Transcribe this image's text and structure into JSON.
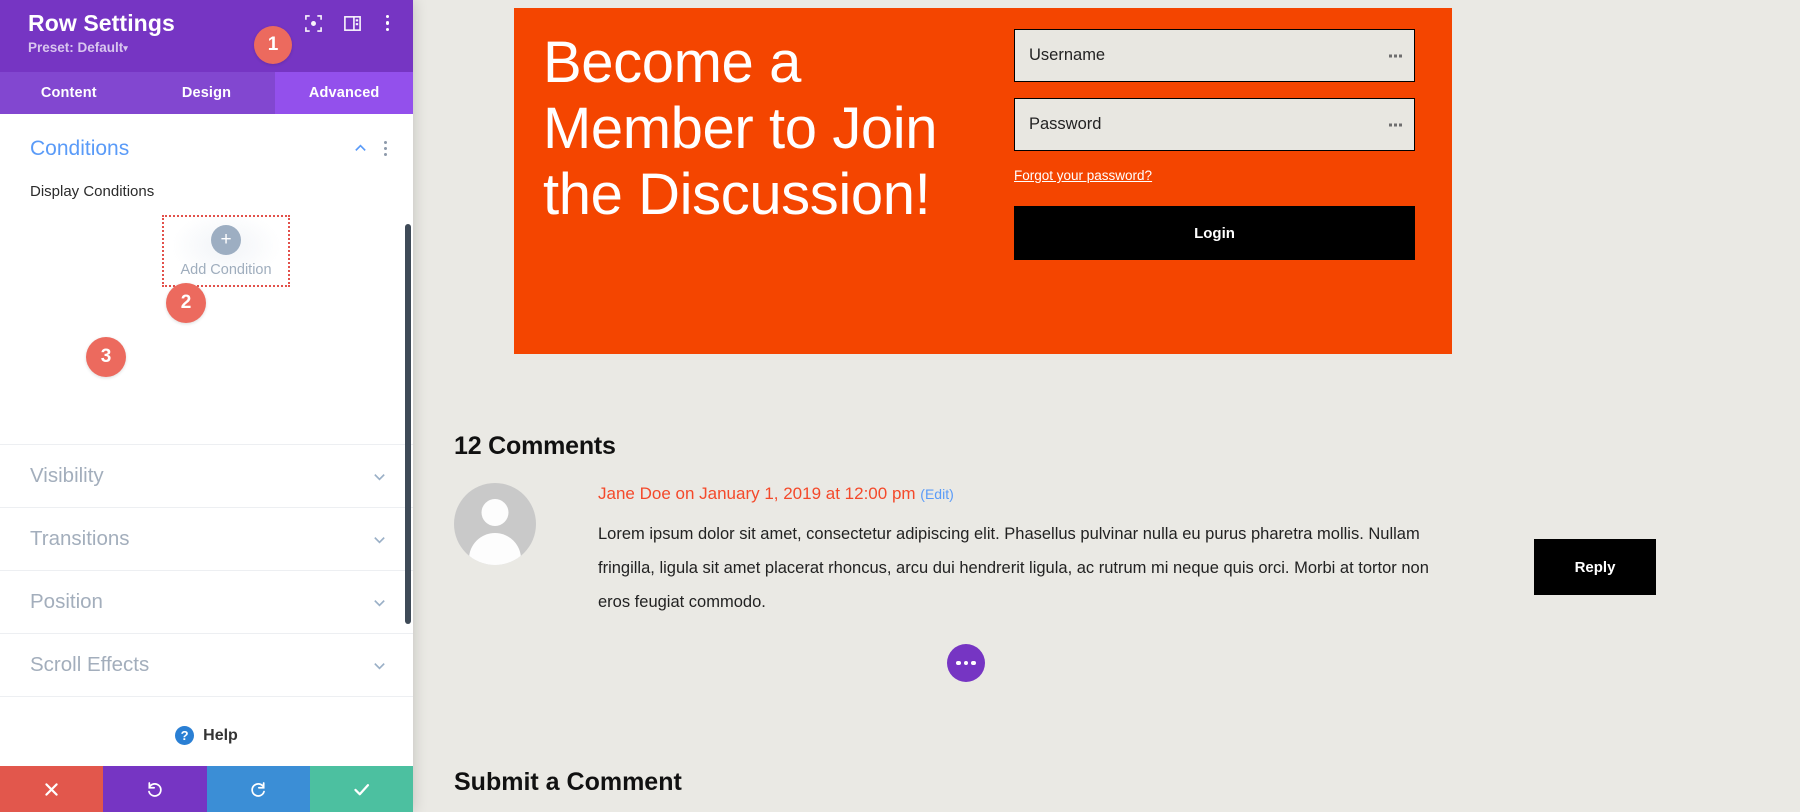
{
  "sidebar": {
    "title": "Row Settings",
    "preset": "Preset: Default",
    "caret": "▾",
    "header_icons": [
      {
        "name": "focus-target-icon"
      },
      {
        "name": "layout-panel-icon"
      },
      {
        "name": "more-vertical-icon"
      }
    ],
    "tabs": [
      {
        "label": "Content",
        "active": false
      },
      {
        "label": "Design",
        "active": false
      },
      {
        "label": "Advanced",
        "active": true
      }
    ],
    "conditions": {
      "title": "Conditions",
      "display_label": "Display Conditions",
      "add_condition_label": "Add Condition",
      "plus_glyph": "+"
    },
    "accordion": [
      {
        "label": "Visibility"
      },
      {
        "label": "Transitions"
      },
      {
        "label": "Position"
      },
      {
        "label": "Scroll Effects"
      }
    ],
    "help_label": "Help",
    "help_glyph": "?",
    "footer": [
      {
        "name": "cancel-button",
        "glyph": "✕"
      },
      {
        "name": "undo-button",
        "glyph": "↺"
      },
      {
        "name": "redo-button",
        "glyph": "↻"
      },
      {
        "name": "save-button",
        "glyph": "✓"
      }
    ]
  },
  "badges": [
    {
      "number": "1"
    },
    {
      "number": "2"
    },
    {
      "number": "3"
    }
  ],
  "hero": {
    "heading": "Become a Member to Join the Discussion!",
    "background_color": "#f44500",
    "form": {
      "username_placeholder": "Username",
      "password_placeholder": "Password",
      "forgot_label": "Forgot your password?",
      "login_label": "Login"
    }
  },
  "comments": {
    "count_heading": "12 Comments",
    "items": [
      {
        "meta": "Jane Doe on January 1, 2019 at 12:00 pm",
        "edit_label": "(Edit)",
        "text": "Lorem ipsum dolor sit amet, consectetur adipiscing elit. Phasellus pulvinar nulla eu purus pharetra mollis. Nullam fringilla, ligula sit amet placerat rhoncus, arcu dui hendrerit ligula, ac rutrum mi neque quis orci. Morbi at tortor non eros feugiat commodo.",
        "reply_label": "Reply"
      }
    ],
    "submit_heading": "Submit a Comment"
  },
  "colors": {
    "brand_purple": "#7635c3",
    "tab_active": "#9350ec",
    "accent_blue": "#5a9bf8",
    "badge_red": "#ec6a5e",
    "hero_orange": "#f44500",
    "save_green": "#4cc0a0"
  }
}
